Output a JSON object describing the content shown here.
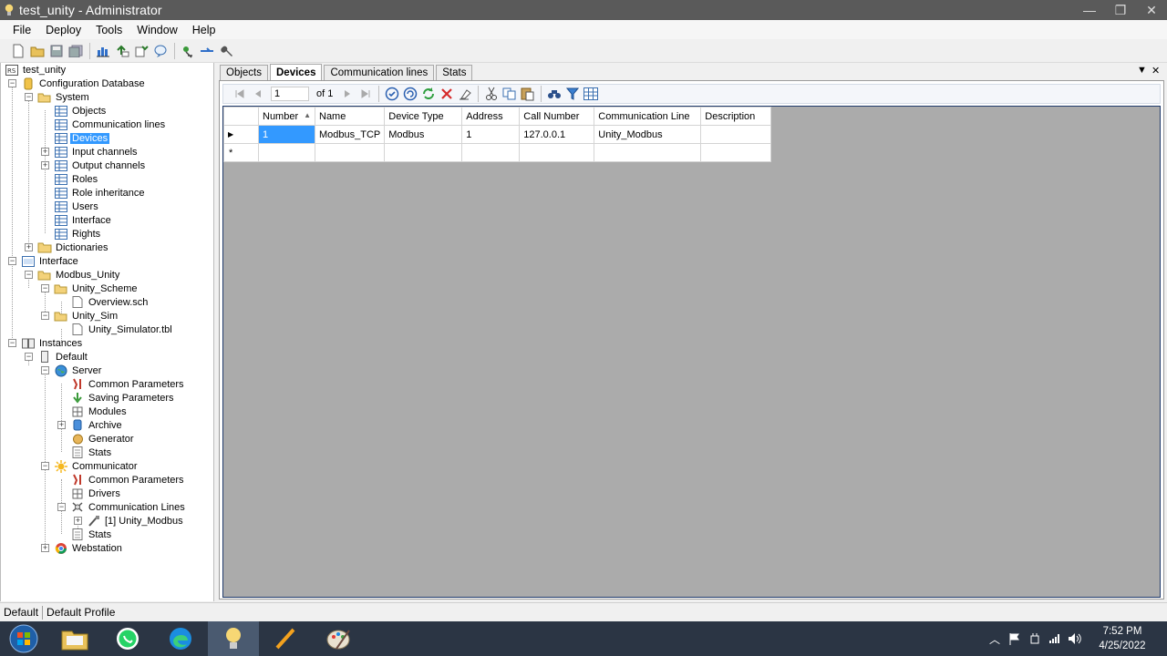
{
  "window": {
    "title": "test_unity - Administrator",
    "controls": [
      "—",
      "❐",
      "✕"
    ]
  },
  "menu": [
    "File",
    "Deploy",
    "Tools",
    "Window",
    "Help"
  ],
  "tree": {
    "root": "test_unity",
    "config_db": "Configuration Database",
    "system": "System",
    "system_items": [
      "Objects",
      "Communication lines",
      "Devices",
      "Input channels",
      "Output channels",
      "Roles",
      "Role inheritance",
      "Users",
      "Interface",
      "Rights"
    ],
    "dictionaries": "Dictionaries",
    "interface": "Interface",
    "modbus_unity": "Modbus_Unity",
    "unity_scheme": "Unity_Scheme",
    "overview": "Overview.sch",
    "unity_sim": "Unity_Sim",
    "unity_simulator": "Unity_Simulator.tbl",
    "instances": "Instances",
    "default": "Default",
    "server": "Server",
    "server_items": [
      "Common Parameters",
      "Saving Parameters",
      "Modules",
      "Archive",
      "Generator",
      "Stats"
    ],
    "communicator": "Communicator",
    "comm_items": [
      "Common Parameters",
      "Drivers",
      "Communication Lines"
    ],
    "comm_line": "[1] Unity_Modbus",
    "comm_stats": "Stats",
    "webstation": "Webstation"
  },
  "tabs": [
    "Objects",
    "Devices",
    "Communication lines",
    "Stats"
  ],
  "pane_controls": {
    "dropdown": "▼",
    "close": "✕"
  },
  "nav": {
    "position": "1",
    "of_label": "of 1"
  },
  "grid": {
    "columns": [
      "Number",
      "Name",
      "Device Type",
      "Address",
      "Call Number",
      "Communication Line",
      "Description"
    ],
    "rows": [
      {
        "marker": "▶",
        "cells": [
          "1",
          "Modbus_TCP",
          "Modbus",
          "1",
          "127.0.0.1",
          "Unity_Modbus",
          ""
        ]
      }
    ],
    "new_row_marker": "*"
  },
  "status": {
    "left": "Default",
    "right": "Default Profile"
  },
  "clock": {
    "time": "7:52 PM",
    "date": "4/25/2022"
  },
  "tray_caret": "︿"
}
